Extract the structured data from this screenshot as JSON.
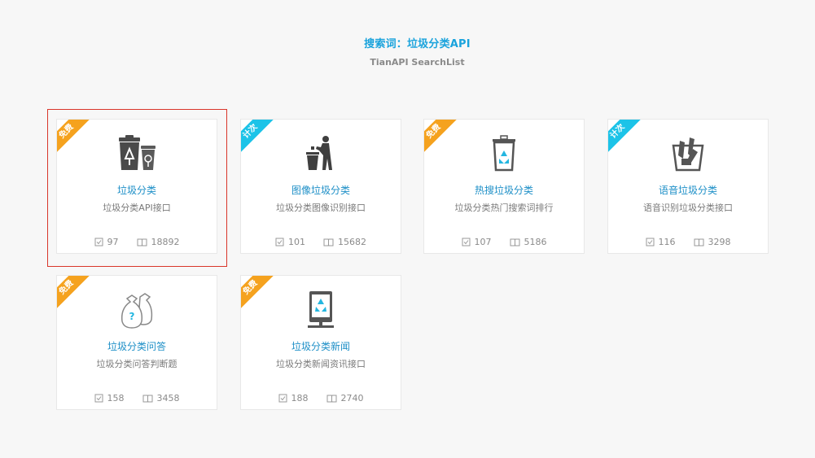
{
  "header": {
    "title": "搜索词：垃圾分类API",
    "subtitle": "TianAPI SearchList"
  },
  "cards": [
    {
      "ribbon": "免费",
      "ribbon_type": "free",
      "name": "垃圾分类",
      "desc": "垃圾分类API接口",
      "uses": "97",
      "views": "18892",
      "icon": "trash-bins-icon",
      "selected": true
    },
    {
      "ribbon": "计次",
      "ribbon_type": "paid",
      "name": "图像垃圾分类",
      "desc": "垃圾分类图像识别接口",
      "uses": "101",
      "views": "15682",
      "icon": "person-throwing-trash-icon"
    },
    {
      "ribbon": "免费",
      "ribbon_type": "free",
      "name": "热搜垃圾分类",
      "desc": "垃圾分类热门搜索词排行",
      "uses": "107",
      "views": "5186",
      "icon": "recycle-bin-icon"
    },
    {
      "ribbon": "计次",
      "ribbon_type": "paid",
      "name": "语音垃圾分类",
      "desc": "语音识别垃圾分类接口",
      "uses": "116",
      "views": "3298",
      "icon": "basket-trash-icon"
    },
    {
      "ribbon": "免费",
      "ribbon_type": "free",
      "name": "垃圾分类问答",
      "desc": "垃圾分类问答判断题",
      "uses": "158",
      "views": "3458",
      "icon": "question-bags-icon"
    },
    {
      "ribbon": "免费",
      "ribbon_type": "free",
      "name": "垃圾分类新闻",
      "desc": "垃圾分类新闻资讯接口",
      "uses": "188",
      "views": "2740",
      "icon": "recycle-tablet-icon"
    }
  ],
  "colors": {
    "accent": "#1aa3dc",
    "free_ribbon": "#f5a21e",
    "paid_ribbon": "#1cc3e8",
    "selected_border": "#d9362a"
  }
}
